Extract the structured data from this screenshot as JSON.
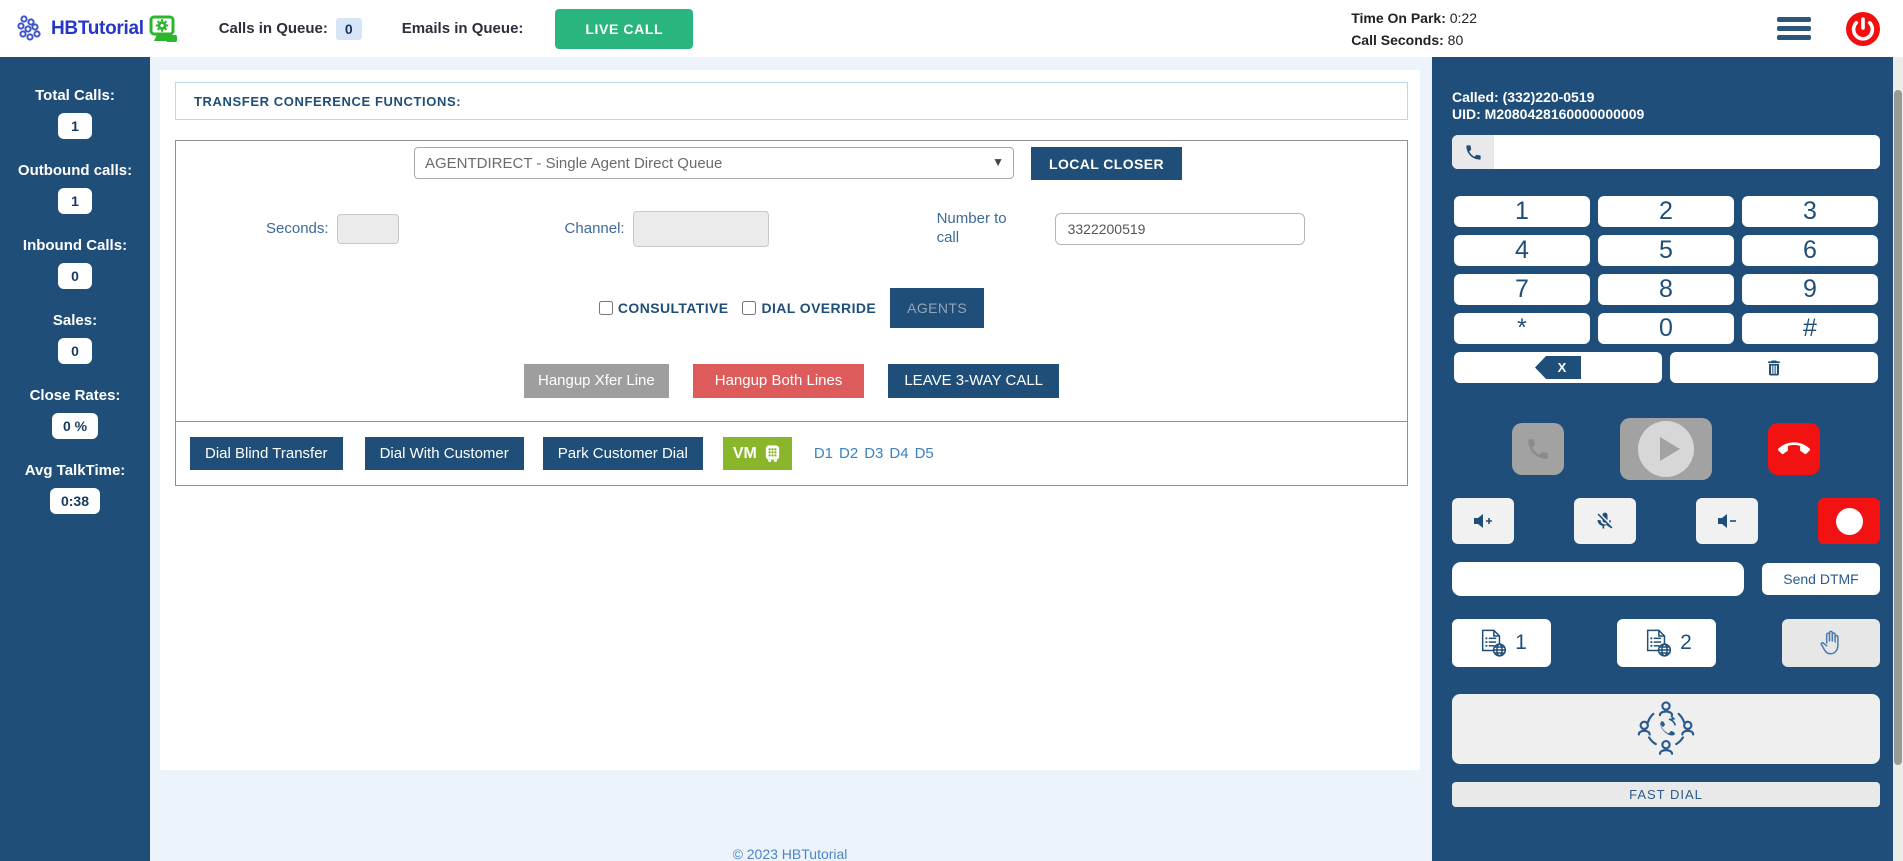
{
  "header": {
    "logo_text": "HBTutorial",
    "calls_in_queue_label": "Calls in Queue:",
    "calls_in_queue_value": "0",
    "emails_in_queue_label": "Emails in Queue:",
    "live_call_button": "LIVE CALL",
    "time_on_park_label": "Time On Park:",
    "time_on_park_value": "0:22",
    "call_seconds_label": "Call Seconds:",
    "call_seconds_value": "80"
  },
  "sidebar": {
    "stats": [
      {
        "label": "Total Calls:",
        "value": "1"
      },
      {
        "label": "Outbound calls:",
        "value": "1"
      },
      {
        "label": "Inbound Calls:",
        "value": "0"
      },
      {
        "label": "Sales:",
        "value": "0"
      },
      {
        "label": "Close Rates:",
        "value": "0 %"
      },
      {
        "label": "Avg TalkTime:",
        "value": "0:38"
      }
    ]
  },
  "main": {
    "section_title": "TRANSFER CONFERENCE FUNCTIONS:",
    "queue_select_value": "AGENTDIRECT - Single Agent Direct Queue",
    "local_closer_button": "LOCAL CLOSER",
    "seconds_label": "Seconds:",
    "seconds_value": "",
    "channel_label": "Channel:",
    "channel_value": "",
    "number_to_call_label": "Number to call",
    "number_to_call_value": "3322200519",
    "consultative_label": "CONSULTATIVE",
    "dial_override_label": "DIAL OVERRIDE",
    "agents_button": "AGENTS",
    "hangup_xfer_button": "Hangup Xfer Line",
    "hangup_both_button": "Hangup Both Lines",
    "leave_3way_button": "LEAVE 3-WAY CALL",
    "dial_blind_button": "Dial Blind Transfer",
    "dial_with_customer_button": "Dial With Customer",
    "park_customer_button": "Park Customer Dial",
    "vm_button": "VM",
    "d_links": [
      "D1",
      "D2",
      "D3",
      "D4",
      "D5"
    ],
    "footer": "© 2023 HBTutorial"
  },
  "phone_panel": {
    "called_label": "Called: (332)220-0519",
    "uid_label": "UID: M2080428160000000009",
    "dial_input_value": "",
    "keypad": [
      [
        "1",
        "2",
        "3"
      ],
      [
        "4",
        "5",
        "6"
      ],
      [
        "7",
        "8",
        "9"
      ],
      [
        "*",
        "0",
        "#"
      ]
    ],
    "backspace_label": "X",
    "dtmf_input_value": "",
    "send_dtmf_button": "Send DTMF",
    "webform1_label": "1",
    "webform2_label": "2",
    "fast_dial_button": "FAST DIAL"
  },
  "colors": {
    "panel_blue": "#1e4e79",
    "button_blue": "#1f4e78",
    "live_call_green": "#2bb57e",
    "vm_green": "#8ab62c",
    "hangup_red": "#dd5b5b",
    "bright_red": "#f21212",
    "gray_button": "#9e9e9e",
    "badge_blue": "#d6e6f8",
    "main_bg": "#edf3fb",
    "link_blue": "#3b82c4"
  }
}
